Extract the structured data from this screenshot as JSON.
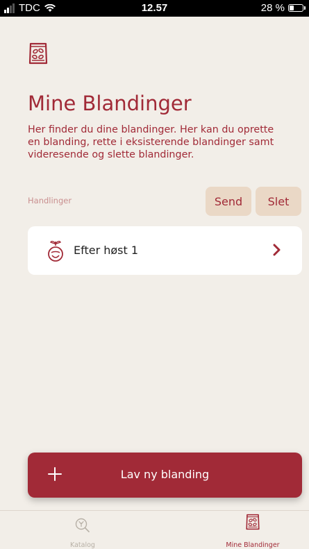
{
  "status_bar": {
    "carrier": "TDC",
    "time": "12.57",
    "battery": "28 %"
  },
  "page": {
    "title": "Mine Blandinger",
    "description": "Her finder du dine blandinger. Her kan du oprette en blanding, rette i eksisterende blandinger samt videresende og slette blandinger."
  },
  "actions": {
    "label": "Handlinger",
    "send_label": "Send",
    "delete_label": "Slet"
  },
  "blends": [
    {
      "name": "Efter høst 1",
      "icon": "sprout-seed-icon"
    }
  ],
  "new_button": {
    "label": "Lav ny blanding",
    "icon": "plus-icon"
  },
  "tabs": [
    {
      "label": "Katalog",
      "icon": "seed-search-icon",
      "active": false
    },
    {
      "label": "Mine Blandinger",
      "icon": "seed-bag-icon",
      "active": true
    }
  ],
  "colors": {
    "accent": "#a12a37",
    "background": "#f2eee8",
    "button_light": "#ead8c6",
    "inactive": "#b7b0a6"
  }
}
